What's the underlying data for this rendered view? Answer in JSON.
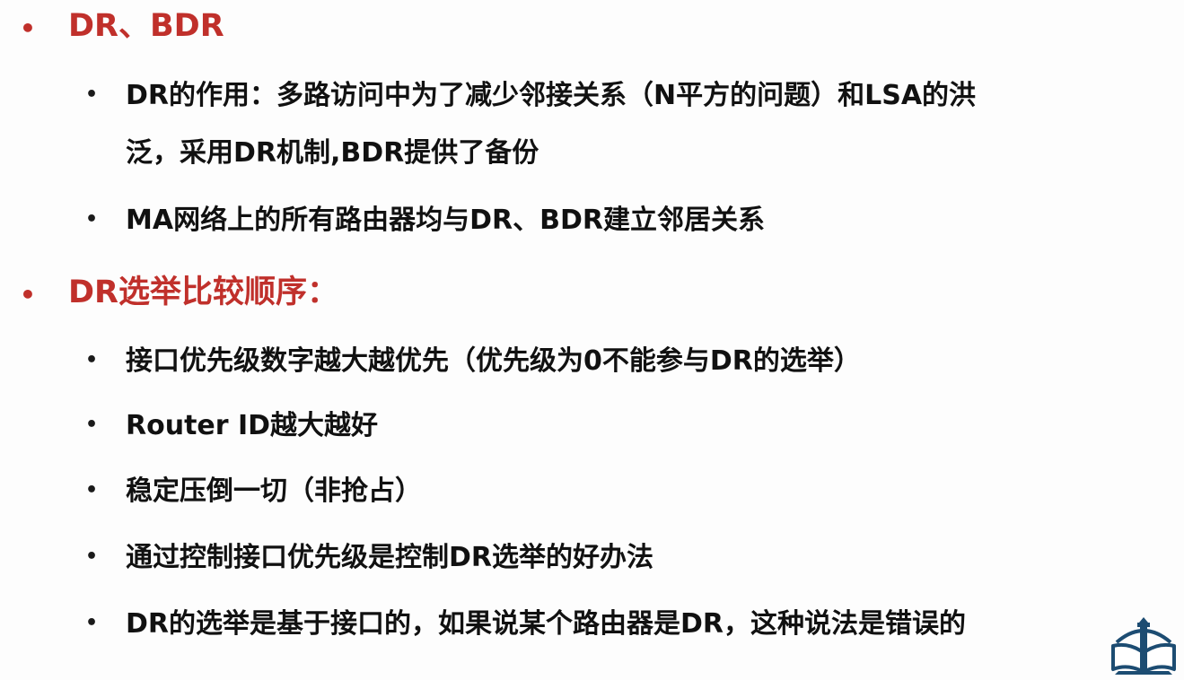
{
  "sections": [
    {
      "bullet": "•",
      "title": "DR、BDR",
      "items": [
        {
          "bullet": "•",
          "text": "DR的作用：多路访问中为了减少邻接关系（N平方的问题）和LSA的洪\n泛，采用DR机制,BDR提供了备份"
        },
        {
          "bullet": "•",
          "text": "MA网络上的所有路由器均与DR、BDR建立邻居关系"
        }
      ]
    },
    {
      "bullet": "•",
      "title": "DR选举比较顺序：",
      "items": [
        {
          "bullet": "•",
          "text": "接口优先级数字越大越优先（优先级为0不能参与DR的选举）"
        },
        {
          "bullet": "•",
          "text": "Router ID越大越好"
        },
        {
          "bullet": "•",
          "text": "稳定压倒一切（非抢占）"
        },
        {
          "bullet": "•",
          "text": "通过控制接口优先级是控制DR选举的好办法"
        },
        {
          "bullet": "•",
          "text": "DR的选举是基于接口的，如果说某个路由器是DR，这种说法是错误的"
        }
      ]
    }
  ],
  "colors": {
    "heading": "#c0302b",
    "body": "#111111",
    "logo": "#1c4c72"
  },
  "icons": {
    "logo": "book-lighthouse-logo-icon"
  }
}
